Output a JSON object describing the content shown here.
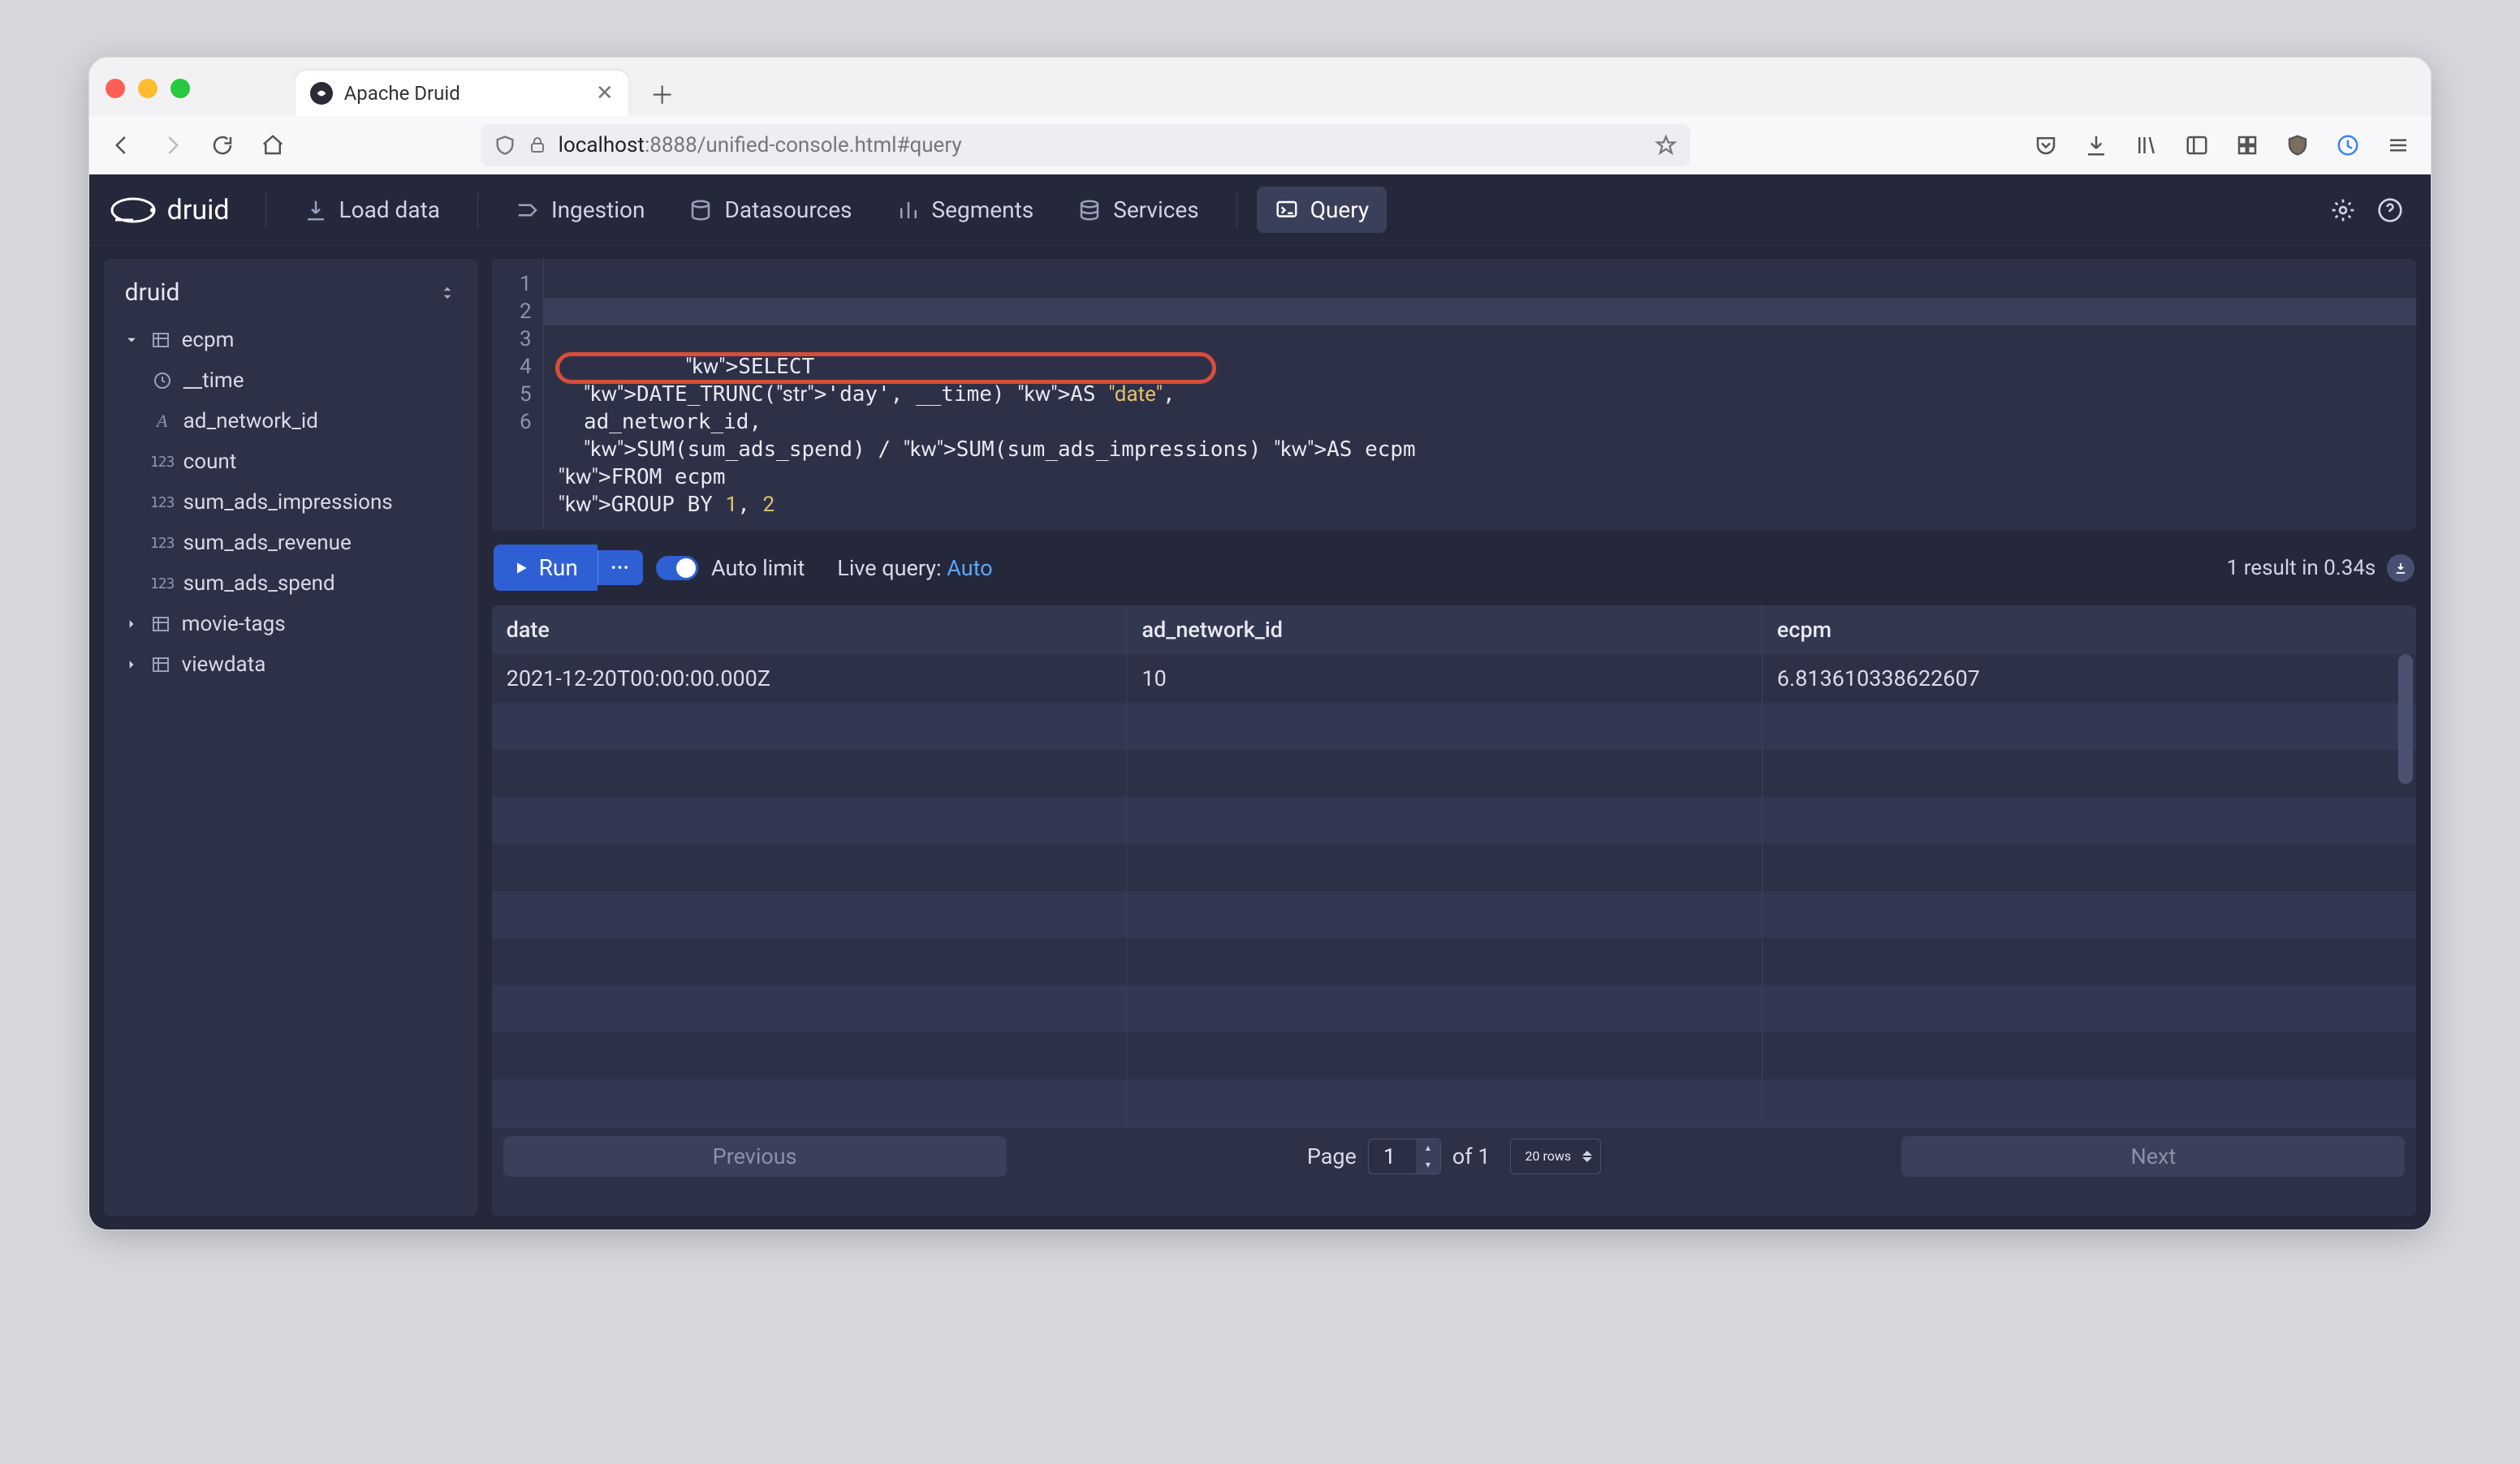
{
  "browser": {
    "tab_title": "Apache Druid",
    "url_host": "localhost",
    "url_rest": ":8888/unified-console.html#query"
  },
  "header": {
    "brand": "druid",
    "nav": {
      "load_data": "Load data",
      "ingestion": "Ingestion",
      "datasources": "Datasources",
      "segments": "Segments",
      "services": "Services",
      "query": "Query"
    }
  },
  "sidebar": {
    "title": "druid",
    "datasources": [
      {
        "name": "ecpm",
        "expanded": true,
        "columns": [
          {
            "name": "__time",
            "type": "time"
          },
          {
            "name": "ad_network_id",
            "type": "string"
          },
          {
            "name": "count",
            "type": "number"
          },
          {
            "name": "sum_ads_impressions",
            "type": "number"
          },
          {
            "name": "sum_ads_revenue",
            "type": "number"
          },
          {
            "name": "sum_ads_spend",
            "type": "number"
          }
        ]
      },
      {
        "name": "movie-tags",
        "expanded": false
      },
      {
        "name": "viewdata",
        "expanded": false
      }
    ]
  },
  "editor": {
    "lines": [
      "SELECT",
      "  DATE_TRUNC('day', __time) AS \"date\",",
      "  ad_network_id,",
      "  SUM(sum_ads_spend) / SUM(sum_ads_impressions) AS ecpm",
      "FROM ecpm",
      "GROUP BY 1, 2"
    ]
  },
  "runbar": {
    "run": "Run",
    "auto_limit": "Auto limit",
    "live_query_label": "Live query: ",
    "live_query_value": "Auto",
    "result_info": "1 result in 0.34s"
  },
  "results": {
    "columns": [
      "date",
      "ad_network_id",
      "ecpm"
    ],
    "rows": [
      [
        "2021-12-20T00:00:00.000Z",
        "10",
        "6.813610338622607"
      ]
    ],
    "blank_rows": 9
  },
  "pager": {
    "previous": "Previous",
    "next": "Next",
    "page_label": "Page",
    "page_value": "1",
    "of_label": "of 1",
    "rows_label": "20 rows"
  }
}
